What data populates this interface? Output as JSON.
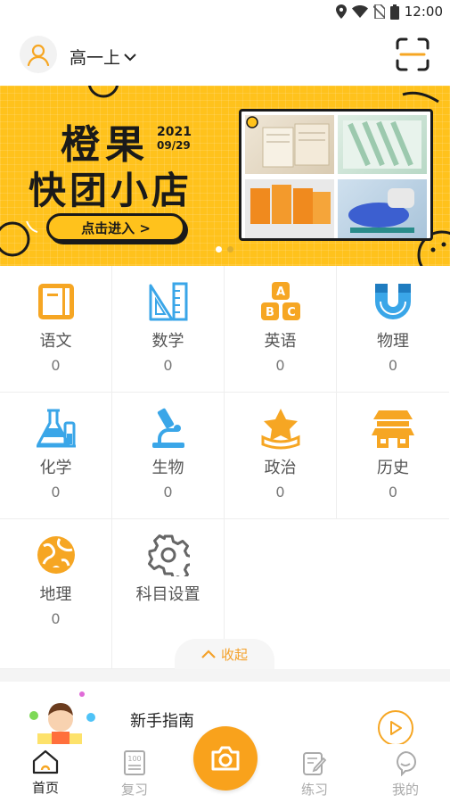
{
  "status_bar": {
    "time": "12:00"
  },
  "header": {
    "grade": "高一上"
  },
  "banner": {
    "title_line1": "橙果",
    "title_line2": "快团小店",
    "year": "2021",
    "date": "09/29",
    "enter_label": "点击进入 >",
    "active_slide": 1,
    "slide_count": 2
  },
  "subjects": [
    {
      "name": "语文",
      "count": "0",
      "icon": "chinese-book-icon"
    },
    {
      "name": "数学",
      "count": "0",
      "icon": "math-ruler-icon"
    },
    {
      "name": "英语",
      "count": "0",
      "icon": "english-abc-blocks-icon"
    },
    {
      "name": "物理",
      "count": "0",
      "icon": "physics-magnet-icon"
    },
    {
      "name": "化学",
      "count": "0",
      "icon": "chemistry-flask-icon"
    },
    {
      "name": "生物",
      "count": "0",
      "icon": "biology-microscope-icon"
    },
    {
      "name": "政治",
      "count": "0",
      "icon": "politics-star-icon"
    },
    {
      "name": "历史",
      "count": "0",
      "icon": "history-building-icon"
    },
    {
      "name": "地理",
      "count": "0",
      "icon": "geography-globe-icon"
    },
    {
      "name": "科目设置",
      "icon": "gear-icon"
    }
  ],
  "collapse_label": "收起",
  "guide": {
    "title": "新手指南"
  },
  "nav": [
    {
      "label": "首页",
      "active": true
    },
    {
      "label": "复习",
      "active": false
    },
    {
      "label": "练习",
      "active": false
    },
    {
      "label": "我的",
      "active": false
    }
  ],
  "colors": {
    "accent": "#f9a21c",
    "banner": "#ffc21c",
    "icon_orange": "#f6a623",
    "icon_blue": "#3aa6e8"
  }
}
